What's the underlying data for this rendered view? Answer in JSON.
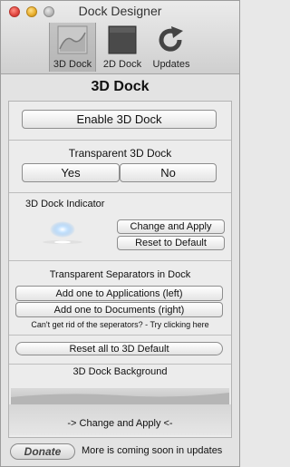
{
  "window": {
    "title": "Dock Designer"
  },
  "toolbar": {
    "items": [
      {
        "label": "3D Dock",
        "icon": "3d-dock-icon",
        "active": true
      },
      {
        "label": "2D Dock",
        "icon": "2d-dock-icon",
        "active": false
      },
      {
        "label": "Updates",
        "icon": "refresh-icon",
        "active": false
      }
    ]
  },
  "page": {
    "heading": "3D Dock"
  },
  "enable": {
    "button": "Enable 3D Dock"
  },
  "transparent": {
    "title": "Transparent 3D Dock",
    "yes": "Yes",
    "no": "No"
  },
  "indicator": {
    "title": "3D Dock Indicator",
    "apply": "Change and Apply",
    "reset": "Reset to Default"
  },
  "separators": {
    "title": "Transparent Separators in Dock",
    "add_apps": "Add one to Applications (left)",
    "add_docs": "Add one to Documents (right)",
    "hint": "Can't get rid of the seperators? - Try clicking here"
  },
  "reset_all": {
    "button": "Reset all to 3D Default"
  },
  "background": {
    "title": "3D Dock Background",
    "apply": "-> Change and Apply <-"
  },
  "footer": {
    "donate": "Donate",
    "note": "More is coming soon in updates"
  }
}
